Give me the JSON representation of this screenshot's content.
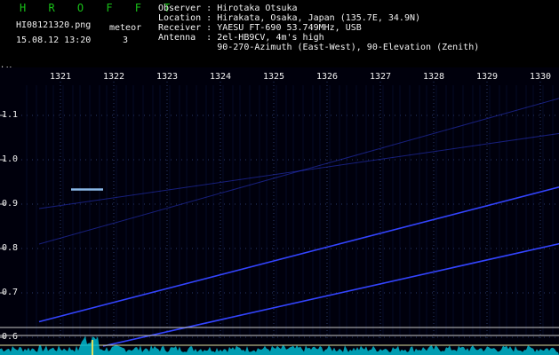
{
  "header": {
    "brand": "H R O F F T",
    "filename": "HI08121320.png",
    "meteor_label": "meteor",
    "datetime": "15.08.12 13:20",
    "meteor_count": "3"
  },
  "info": {
    "rows": [
      "Observer : Hirotaka Otsuka",
      "Location : Hirakata, Osaka, Japan (135.7E, 34.9N)",
      "Receiver : YAESU FT-690 53.749MHz, USB",
      "Antenna  : 2el-HB9CV, 4m's high",
      "           90-270-Azimuth (East-West), 90-Elevation (Zenith)"
    ]
  },
  "chart_data": {
    "type": "spectrogram",
    "ylabel": "kHz",
    "x_ticks": [
      "1321",
      "1322",
      "1323",
      "1324",
      "1325",
      "1326",
      "1327",
      "1328",
      "1329",
      "1330"
    ],
    "y_ticks": [
      "1.1",
      "1.0",
      "0.9",
      "0.8",
      "0.7",
      "0.6"
    ],
    "y_tick_values": [
      1.1,
      1.0,
      0.9,
      0.8,
      0.7,
      0.6
    ],
    "ylim": [
      0.58,
      1.18
    ],
    "traces": [
      {
        "from": [
          1320.6,
          0.635
        ],
        "to": [
          1330.4,
          0.94
        ]
      },
      {
        "from": [
          1321.8,
          0.58
        ],
        "to": [
          1330.4,
          0.812
        ]
      },
      {
        "from": [
          1320.6,
          0.89
        ],
        "to": [
          1330.4,
          1.06
        ]
      },
      {
        "from": [
          1320.6,
          0.81
        ],
        "to": [
          1330.4,
          1.14
        ]
      }
    ],
    "meteor_echo": {
      "x": [
        1321.2,
        1321.8
      ],
      "y": 0.933
    },
    "colors": {
      "grid": "#2a3a6a",
      "trace": "#3344ff",
      "echo": "#99ccff",
      "noise": "#00b8d0",
      "hline": "#c8c8c8"
    }
  }
}
